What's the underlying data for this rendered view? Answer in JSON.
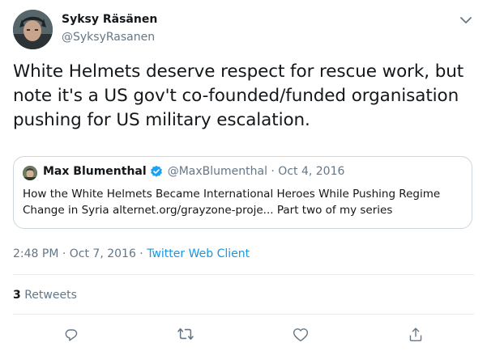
{
  "tweet": {
    "author": {
      "name": "Syksy Räsänen",
      "handle": "@SyksyRasanen"
    },
    "text": "White Helmets deserve respect for rescue work, but note it's a US gov't co-founded/funded organisation pushing for US military escalation.",
    "quoted": {
      "name": "Max Blumenthal",
      "handle_date": "@MaxBlumenthal · Oct 4, 2016",
      "verified": true,
      "body": "How the White Helmets Became International Heroes While Pushing Regime Change in Syria alternet.org/grayzone-proje... Part two of my series"
    },
    "timestamp": "2:48 PM · Oct 7, 2016 · ",
    "client": "Twitter Web Client",
    "retweet_count": "3",
    "retweet_label": "Retweets"
  },
  "icons": {
    "caret": "chevron-down-icon",
    "verified": "verified-badge-icon",
    "actions": [
      "reply-icon",
      "retweet-icon",
      "like-icon",
      "share-icon"
    ]
  },
  "colors": {
    "text": "#14171a",
    "secondary": "#657786",
    "link": "#1b95e0",
    "border": "#ccd6dd",
    "verified": "#1da1f2"
  }
}
